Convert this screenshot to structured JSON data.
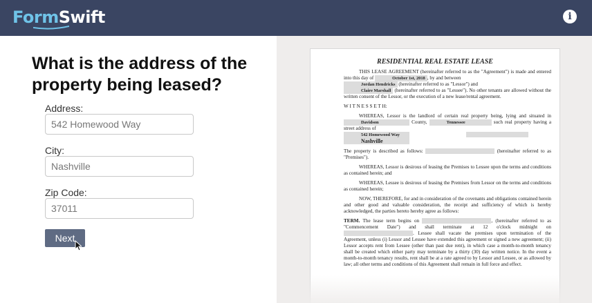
{
  "header": {
    "logo_form": "Form",
    "logo_swift": "Swift",
    "info_icon": "info-icon"
  },
  "form": {
    "question": "What is the address of the property being leased?",
    "address_label": "Address:",
    "address_value": "542 Homewood Way",
    "city_label": "City:",
    "city_value": "Nashville",
    "zip_label": "Zip Code:",
    "zip_value": "37011",
    "next_label": "Next"
  },
  "document": {
    "title": "RESIDENTIAL REAL ESTATE LEASE",
    "p1_a": "THIS LEASE AGREEMENT (hereinafter referred to as the \"Agreement\") is made and entered into this day of",
    "date": "October 1st, 2018",
    "p1_b": ", by and between",
    "lessor": "Jordan Hendricks",
    "p1_c": "(hereinafter referred to as \"Lessor\") and",
    "lessee": "Claire Marshall",
    "p1_d": "(hereinafter referred to as \"Lessee\"). No other tenants are allowed without the written consent of the Lessor, or the execution of a new lease/rental agreement.",
    "witnesseth": "W I T N E S S E T H:",
    "p2_a": "WHEREAS, Lessor is the landlord of certain real property being, lying and situated in",
    "county": "Davidson",
    "p2_b": "County,",
    "state": "Tennessee",
    "p2_c": "such real property having a street address of",
    "street": "542 Homewood Way",
    "city": "Nashville",
    "p3_a": "The property is described as follows:",
    "p3_b": "(hereinafter referred to as \"Premises\").",
    "p4": "WHEREAS, Lessor is desirous of leasing the Premises to Lessee upon the terms and conditions as contained herein; and",
    "p5": "WHEREAS, Lessee is desirous of leasing the Premises from Lessor on the terms and conditions as contained herein;",
    "p6": "NOW, THEREFORE, for and in consideration of the covenants and obligations contained herein and other good and valuable consideration, the receipt and sufficiency of which is hereby acknowledged, the parties hereto hereby agree as follows:",
    "term_label": "TERM.",
    "p7_a": "The lease term begins on",
    "p7_b": ", (hereinafter referred to as \"Commencement Date\") and shall terminate at 12 o'clock midnight on",
    "p7_c": ". Lessee shall vacate the premises upon termination of the Agreement, unless (i) Lessor and Lessee have extended this agreement or signed a new agreement; (ii) Lessor accepts rent from Lessee (other than past due rent), in which case a month-to-month tenancy shall be created which either party may terminate by a thirty (30) day written notice. In the event a month-to-month tenancy results, rent shall be at a rate agreed to by Lessor and Lessee, or as allowed by law; all other terms and conditions of this Agreement shall remain in full force and effect."
  }
}
